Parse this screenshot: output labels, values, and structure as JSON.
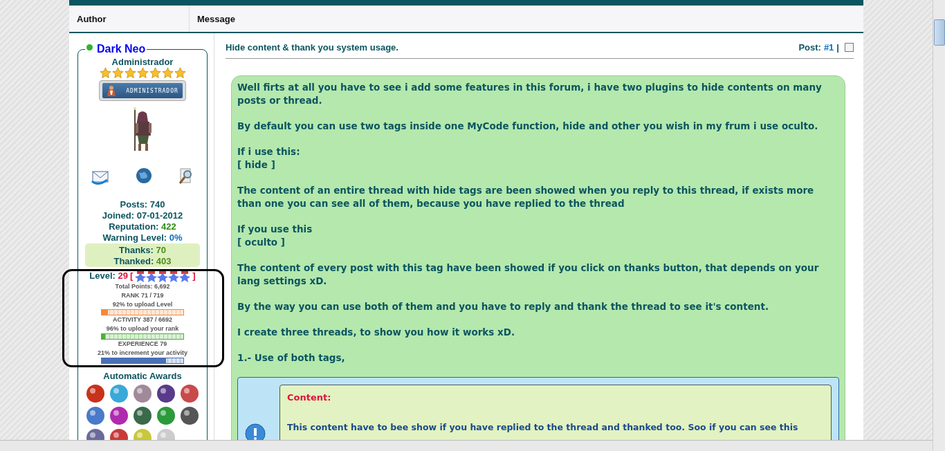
{
  "header": {
    "columns": [
      "Author",
      "Message"
    ]
  },
  "author": {
    "name": "Dark Neo",
    "online": true,
    "title": "Administrador",
    "stars": 7,
    "badge": "ADMINISTRADOR",
    "stats": [
      {
        "label": "Posts:",
        "value": "740",
        "color": "#0b5560"
      },
      {
        "label": "Joined:",
        "value": "07-01-2012",
        "color": "#0b5560"
      },
      {
        "label": "Reputation:",
        "value": "422",
        "color": "#2e8b10"
      },
      {
        "label": "Warning Level:",
        "value": "0%",
        "color": "#0a6fc2"
      }
    ],
    "thanks": [
      {
        "label": "Thanks:",
        "value": "70"
      },
      {
        "label": "Thanked:",
        "value": "403"
      }
    ],
    "level": {
      "label": "Level:",
      "value": "29",
      "open": "[",
      "close": "]"
    },
    "level_lines": [
      {
        "kind": "text",
        "text": "Total Points: 6,692"
      },
      {
        "kind": "text",
        "text": "RANK 71 / 719"
      },
      {
        "kind": "text",
        "text": "92% to upload Level"
      },
      {
        "kind": "bar",
        "level": 0.08,
        "color": "#f28a3c"
      },
      {
        "kind": "text",
        "text": "ACTIVITY 387 / 6692"
      },
      {
        "kind": "text",
        "text": "96% to upload your rank"
      },
      {
        "kind": "bar",
        "level": 0.04,
        "color": "#4caf3a"
      },
      {
        "kind": "text",
        "text": "EXPERIENCE 79"
      },
      {
        "kind": "text",
        "text": "21% to increment your activity"
      },
      {
        "kind": "bar",
        "level": 0.79,
        "color": "#4a70b8"
      }
    ],
    "awards_title": "Automatic Awards"
  },
  "post": {
    "subject": "Hide content & thank you system usage.",
    "post_label": "Post:",
    "post_number": "#1",
    "separator": "|",
    "selected": false,
    "paragraphs": [
      "Well firts at all you have to see i add some features in this forum, i have two plugins to hide contents on many posts or thread.",
      "By default you can use two tags inside one MyCode function, hide and other you wish in my frum i use oculto.",
      "If i use this:\n[ hide ]",
      "The content of an entire thread with hide tags are been showed when you reply to this thread, if exists more than one you can see all of them, because you have replied to the thread",
      "If you use this\n[ oculto ]",
      "The content of every post with this tag have been showed if you click on thanks button, that depends on your lang settings xD.",
      "By the way you can use both of them and you have to reply and thank the thread to see it's content.",
      "I create three threads, to show you how it works xD.",
      "1.- Use of both tags,"
    ],
    "hidden_box": {
      "label": "Content:",
      "text": "This content have to bee show if you have replied to the thread and thanked too. Soo if you can see this"
    }
  }
}
